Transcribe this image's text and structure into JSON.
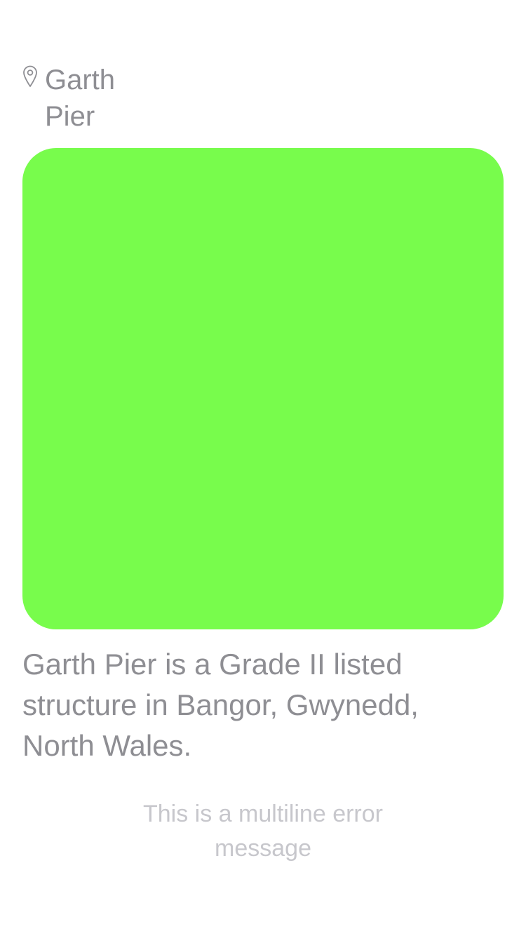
{
  "location": {
    "icon": "map-pin-icon",
    "name": "Garth Pier"
  },
  "image": {
    "color": "#78fc4c"
  },
  "description": "Garth Pier is a Grade II listed structure in Bangor, Gwynedd, North Wales.",
  "error_message": "This is a multiline error message",
  "colors": {
    "text_secondary": "#8e8e93",
    "text_tertiary": "#c7c7cc",
    "background": "#ffffff"
  }
}
